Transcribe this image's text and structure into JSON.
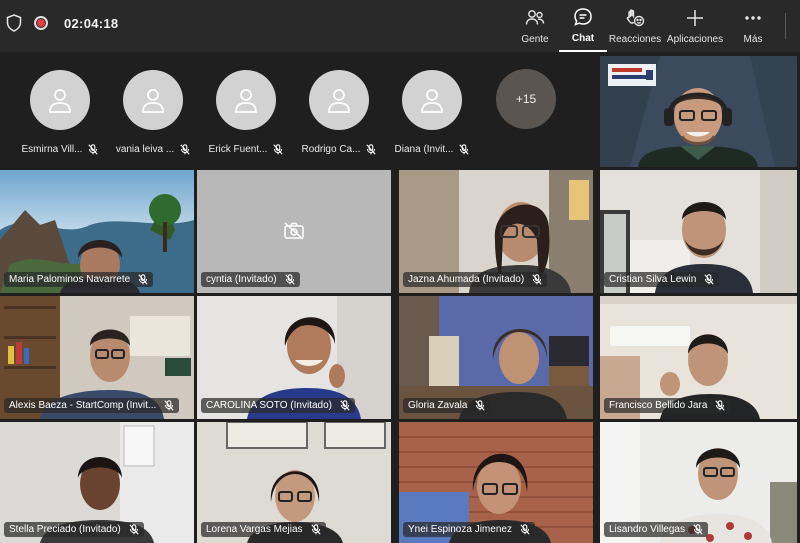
{
  "meeting": {
    "timer": "02:04:18"
  },
  "toolbar": [
    {
      "label": "Gente",
      "icon": "people-icon"
    },
    {
      "label": "Chat",
      "icon": "chat-icon",
      "active": true
    },
    {
      "label": "Reacciones",
      "icon": "reactions-icon"
    },
    {
      "label": "Aplicaciones",
      "icon": "add-apps-icon"
    },
    {
      "label": "Más",
      "icon": "more-icon"
    }
  ],
  "strip": {
    "participants": [
      {
        "name": "Esmirna Vill..."
      },
      {
        "name": "vania leiva ..."
      },
      {
        "name": "Erick Fuent..."
      },
      {
        "name": "Rodrigo Ca..."
      },
      {
        "name": "Diana (Invit..."
      }
    ],
    "overflow": "+15"
  },
  "tiles": [
    {
      "name": "Maria Palominos Navarrete"
    },
    {
      "name": "cyntia (Invitado)"
    },
    {
      "name": "Jazna Ahumada (Invitado)"
    },
    {
      "name": "Cristian Silva Lewin"
    },
    {
      "name": "Alexis Baeza - StartComp (Invit..."
    },
    {
      "name": "CAROLINA SOTO (Invitado)"
    },
    {
      "name": "Gloria Zavala"
    },
    {
      "name": "Francisco Bellido Jara"
    },
    {
      "name": "Stella Preciado (Invitado)"
    },
    {
      "name": "Lorena Vargas Mejias"
    },
    {
      "name": "Ynei Espinoza Jimenez"
    },
    {
      "name": "Lisandro Villegas"
    }
  ]
}
